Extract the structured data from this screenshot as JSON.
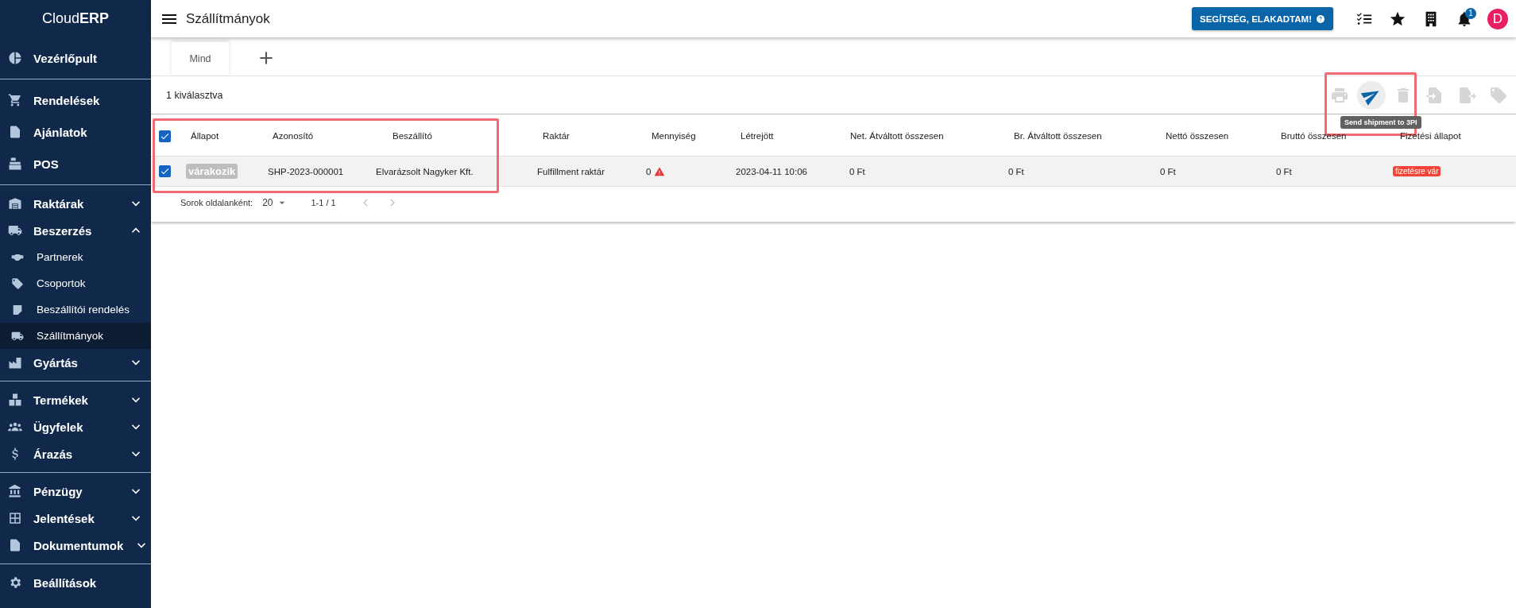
{
  "sidebar": {
    "logo": "Cloud**ERP**",
    "sections": [
      {
        "items": [
          {
            "label": "Vezérlőpult",
            "kind": "link",
            "selected": false
          }
        ]
      },
      {
        "items": [
          {
            "label": "Rendelések",
            "kind": "link",
            "selected": false
          },
          {
            "label": "Ajánlatok",
            "kind": "link",
            "selected": false
          },
          {
            "label": "POS",
            "kind": "link",
            "selected": false
          }
        ]
      },
      {
        "items": [
          {
            "label": "Raktárak",
            "kind": "group",
            "expanded": false,
            "selected": false
          },
          {
            "label": "Beszerzés",
            "kind": "group",
            "expanded": true,
            "selected": false,
            "children": [
              {
                "label": "Partnerek",
                "selected": false
              },
              {
                "label": "Csoportok",
                "selected": false
              },
              {
                "label": "Beszállítói rendelés",
                "selected": false
              },
              {
                "label": "Szállítmányok",
                "selected": true
              }
            ]
          },
          {
            "label": "Gyártás",
            "kind": "group",
            "expanded": false,
            "selected": false
          }
        ]
      },
      {
        "items": [
          {
            "label": "Termékek",
            "kind": "group",
            "expanded": false,
            "selected": false
          },
          {
            "label": "Ügyfelek",
            "kind": "group",
            "expanded": false,
            "selected": false
          },
          {
            "label": "Árazás",
            "kind": "group",
            "expanded": false,
            "selected": false
          }
        ]
      },
      {
        "items": [
          {
            "label": "Pénzügy",
            "kind": "group",
            "expanded": false,
            "selected": false
          },
          {
            "label": "Jelentések",
            "kind": "group",
            "expanded": false,
            "selected": false
          },
          {
            "label": "Dokumentumok",
            "kind": "group",
            "expanded": false,
            "selected": false
          }
        ]
      },
      {
        "items": [
          {
            "label": "Beállítások",
            "kind": "link",
            "selected": false
          }
        ]
      }
    ]
  },
  "topbar": {
    "title": "Szállítmányok",
    "help_button": "SEGÍTSÉG, ELAKADTAM!",
    "notification_count": "1",
    "avatar": "D"
  },
  "tabs": [
    {
      "label": "Mind",
      "selected": true
    }
  ],
  "toolbar": {
    "selection": "1 kiválasztva",
    "highlighted": true,
    "tooltip": "Send shipment to 3PI",
    "actions": [
      {
        "disabled": true,
        "hovered": false
      },
      {
        "disabled": false,
        "hovered": true
      },
      {
        "disabled": true,
        "hovered": false
      },
      {
        "disabled": true,
        "hovered": false
      },
      {
        "disabled": true,
        "hovered": false
      },
      {
        "disabled": true,
        "hovered": false
      }
    ]
  },
  "table": {
    "highlighted": true,
    "all_checked": true,
    "columns": [
      "Állapot",
      "Azonosító",
      "Beszállító",
      "Raktár",
      "Mennyiség",
      "Létrejött",
      "Net. Átváltott összesen",
      "Br. Átváltott összesen",
      "Nettó összesen",
      "Bruttó összesen",
      "Fizetési állapot"
    ],
    "rows": [
      {
        "checked": true,
        "status": "várakozik",
        "id": "SHP-2023-000001",
        "supplier": "Elvarázsolt Nagyker Kft.",
        "warehouse": "Fulfillment raktár",
        "quantity": "0",
        "quantity_warning": true,
        "created": "2023-04-11 10:06",
        "net_converted": "0 Ft",
        "gross_converted": "0 Ft",
        "net": "0 Ft",
        "gross": "0 Ft",
        "payment_status": "fizetésre vár"
      }
    ]
  },
  "pagination": {
    "rows_label": "Sorok oldalanként:",
    "rows_per_page": "20",
    "range": "1-1 / 1"
  }
}
